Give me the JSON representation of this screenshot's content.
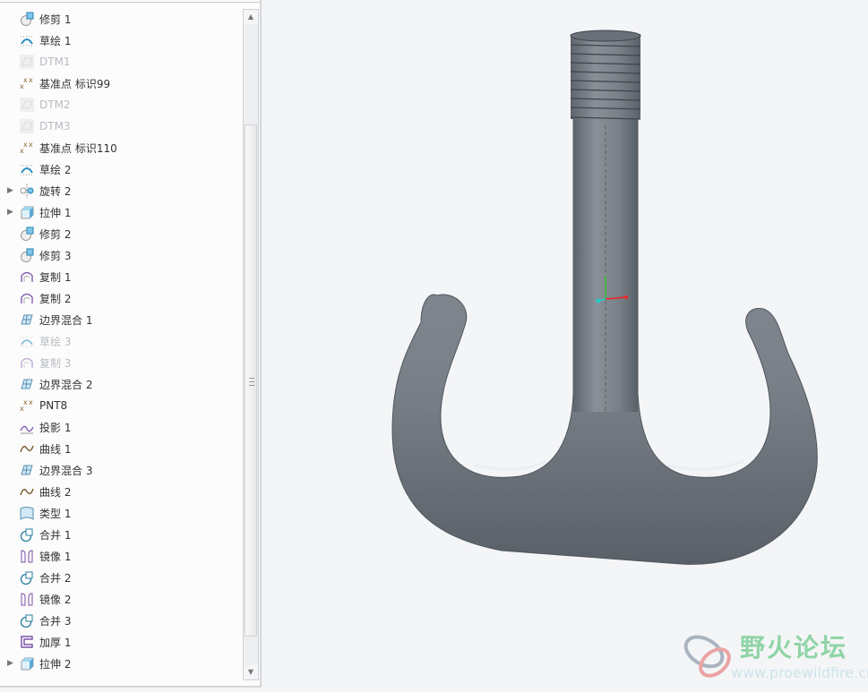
{
  "model_tree": {
    "items": [
      {
        "label": "修剪 1",
        "icon": "trim-icon",
        "expandable": false,
        "dim": false
      },
      {
        "label": "草绘 1",
        "icon": "sketch-icon",
        "expandable": false,
        "dim": false
      },
      {
        "label": "DTM1",
        "icon": "datum-plane-icon",
        "expandable": false,
        "dim": true
      },
      {
        "label": "基准点 标识99",
        "icon": "datum-point-icon",
        "expandable": false,
        "dim": false
      },
      {
        "label": "DTM2",
        "icon": "datum-plane-icon",
        "expandable": false,
        "dim": true
      },
      {
        "label": "DTM3",
        "icon": "datum-plane-icon",
        "expandable": false,
        "dim": true
      },
      {
        "label": "基准点 标识110",
        "icon": "datum-point-icon",
        "expandable": false,
        "dim": false
      },
      {
        "label": "草绘 2",
        "icon": "sketch-icon",
        "expandable": false,
        "dim": false
      },
      {
        "label": "旋转 2",
        "icon": "revolve-icon",
        "expandable": true,
        "dim": false
      },
      {
        "label": "拉伸 1",
        "icon": "extrude-icon",
        "expandable": true,
        "dim": false
      },
      {
        "label": "修剪 2",
        "icon": "trim-icon",
        "expandable": false,
        "dim": false
      },
      {
        "label": "修剪 3",
        "icon": "trim-icon",
        "expandable": false,
        "dim": false
      },
      {
        "label": "复制 1",
        "icon": "copy-icon",
        "expandable": false,
        "dim": false
      },
      {
        "label": "复制 2",
        "icon": "copy-icon",
        "expandable": false,
        "dim": false
      },
      {
        "label": "边界混合 1",
        "icon": "boundary-blend-icon",
        "expandable": false,
        "dim": false
      },
      {
        "label": "草绘 3",
        "icon": "sketch-icon",
        "expandable": false,
        "dim": true
      },
      {
        "label": "复制 3",
        "icon": "copy-icon",
        "expandable": false,
        "dim": true
      },
      {
        "label": "边界混合 2",
        "icon": "boundary-blend-icon",
        "expandable": false,
        "dim": false
      },
      {
        "label": "PNT8",
        "icon": "datum-point-icon",
        "expandable": false,
        "dim": false
      },
      {
        "label": "投影 1",
        "icon": "projection-icon",
        "expandable": false,
        "dim": false
      },
      {
        "label": "曲线 1",
        "icon": "curve-icon",
        "expandable": false,
        "dim": false
      },
      {
        "label": "边界混合 3",
        "icon": "boundary-blend-icon",
        "expandable": false,
        "dim": false
      },
      {
        "label": "曲线 2",
        "icon": "curve-icon",
        "expandable": false,
        "dim": false
      },
      {
        "label": "类型 1",
        "icon": "style-icon",
        "expandable": false,
        "dim": false
      },
      {
        "label": "合并 1",
        "icon": "merge-icon",
        "expandable": false,
        "dim": false
      },
      {
        "label": "镜像 1",
        "icon": "mirror-icon",
        "expandable": false,
        "dim": false
      },
      {
        "label": "合并 2",
        "icon": "merge-icon",
        "expandable": false,
        "dim": false
      },
      {
        "label": "镜像 2",
        "icon": "mirror-icon",
        "expandable": false,
        "dim": false
      },
      {
        "label": "合并 3",
        "icon": "merge-icon",
        "expandable": false,
        "dim": false
      },
      {
        "label": "加厚 1",
        "icon": "thicken-icon",
        "expandable": false,
        "dim": false
      },
      {
        "label": "拉伸 2",
        "icon": "extrude-icon",
        "expandable": true,
        "dim": false
      }
    ]
  },
  "watermark": {
    "title": "野火论坛",
    "url": "www.proewildfire.cn"
  },
  "colors": {
    "model": "#7c828a",
    "accent": "#3a9fd0"
  }
}
